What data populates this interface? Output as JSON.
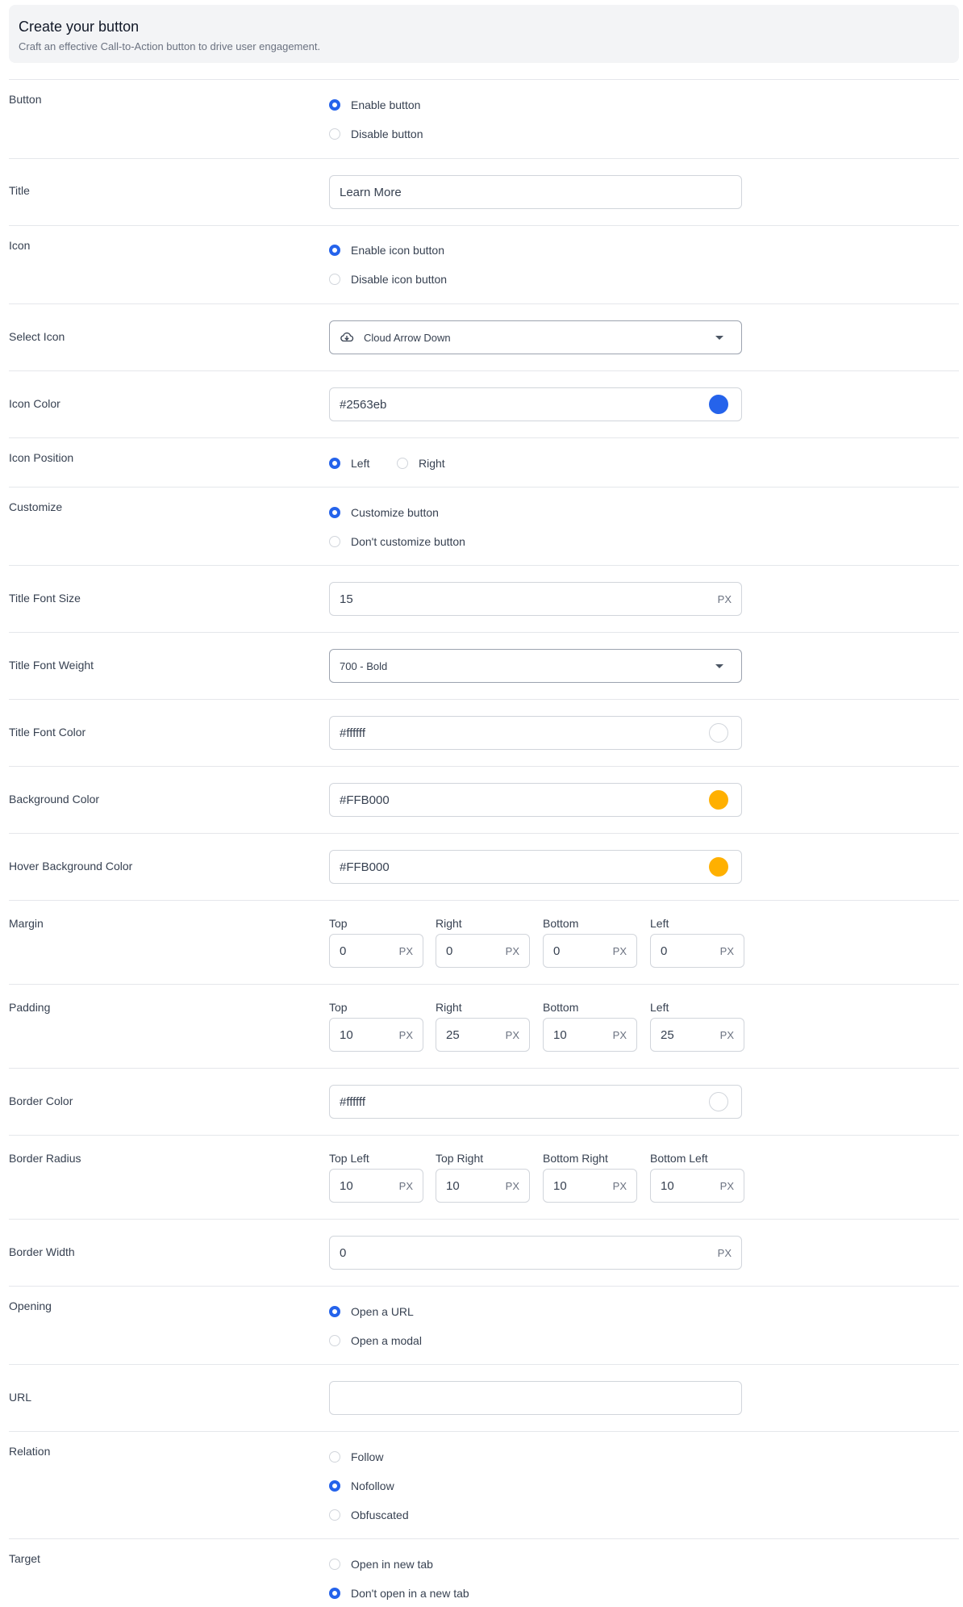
{
  "header": {
    "title": "Create your button",
    "subtitle": "Craft an effective Call-to-Action button to drive user engagement."
  },
  "button": {
    "label": "Button",
    "options": [
      {
        "label": "Enable button",
        "checked": true
      },
      {
        "label": "Disable button",
        "checked": false
      }
    ]
  },
  "title": {
    "label": "Title",
    "value": "Learn More"
  },
  "icon": {
    "label": "Icon",
    "options": [
      {
        "label": "Enable icon button",
        "checked": true
      },
      {
        "label": "Disable icon button",
        "checked": false
      }
    ]
  },
  "select_icon": {
    "label": "Select Icon",
    "value": "Cloud Arrow Down",
    "icon": "cloud-arrow-down-icon"
  },
  "icon_color": {
    "label": "Icon Color",
    "value": "#2563eb",
    "swatch": "#2563eb"
  },
  "icon_position": {
    "label": "Icon Position",
    "options": [
      {
        "label": "Left",
        "checked": true
      },
      {
        "label": "Right",
        "checked": false
      }
    ]
  },
  "customize": {
    "label": "Customize",
    "options": [
      {
        "label": "Customize button",
        "checked": true
      },
      {
        "label": "Don't customize button",
        "checked": false
      }
    ]
  },
  "title_font_size": {
    "label": "Title Font Size",
    "value": "15",
    "unit": "PX"
  },
  "title_font_weight": {
    "label": "Title Font Weight",
    "value": "700 - Bold"
  },
  "title_font_color": {
    "label": "Title Font Color",
    "value": "#ffffff",
    "swatch": "#ffffff"
  },
  "background_color": {
    "label": "Background Color",
    "value": "#FFB000",
    "swatch": "#FFB000"
  },
  "hover_background_color": {
    "label": "Hover Background Color",
    "value": "#FFB000",
    "swatch": "#FFB000"
  },
  "margin": {
    "label": "Margin",
    "fields": [
      {
        "label": "Top",
        "value": "0",
        "unit": "PX"
      },
      {
        "label": "Right",
        "value": "0",
        "unit": "PX"
      },
      {
        "label": "Bottom",
        "value": "0",
        "unit": "PX"
      },
      {
        "label": "Left",
        "value": "0",
        "unit": "PX"
      }
    ]
  },
  "padding": {
    "label": "Padding",
    "fields": [
      {
        "label": "Top",
        "value": "10",
        "unit": "PX"
      },
      {
        "label": "Right",
        "value": "25",
        "unit": "PX"
      },
      {
        "label": "Bottom",
        "value": "10",
        "unit": "PX"
      },
      {
        "label": "Left",
        "value": "25",
        "unit": "PX"
      }
    ]
  },
  "border_color": {
    "label": "Border Color",
    "value": "#ffffff",
    "swatch": "#ffffff"
  },
  "border_radius": {
    "label": "Border Radius",
    "fields": [
      {
        "label": "Top Left",
        "value": "10",
        "unit": "PX"
      },
      {
        "label": "Top Right",
        "value": "10",
        "unit": "PX"
      },
      {
        "label": "Bottom Right",
        "value": "10",
        "unit": "PX"
      },
      {
        "label": "Bottom Left",
        "value": "10",
        "unit": "PX"
      }
    ]
  },
  "border_width": {
    "label": "Border Width",
    "value": "0",
    "unit": "PX"
  },
  "opening": {
    "label": "Opening",
    "options": [
      {
        "label": "Open a URL",
        "checked": true
      },
      {
        "label": "Open a modal",
        "checked": false
      }
    ]
  },
  "url": {
    "label": "URL",
    "value": ""
  },
  "relation": {
    "label": "Relation",
    "options": [
      {
        "label": "Follow",
        "checked": false
      },
      {
        "label": "Nofollow",
        "checked": true
      },
      {
        "label": "Obfuscated",
        "checked": false
      }
    ]
  },
  "target": {
    "label": "Target",
    "options": [
      {
        "label": "Open in new tab",
        "checked": false
      },
      {
        "label": "Don't open in a new tab",
        "checked": true
      }
    ]
  },
  "colors": {
    "accent": "#2563eb",
    "border": "#d1d5db",
    "divider": "#e5e7eb"
  }
}
